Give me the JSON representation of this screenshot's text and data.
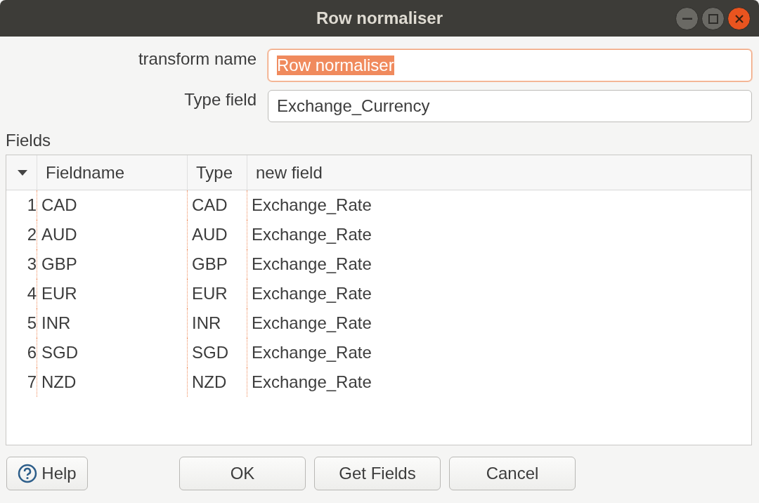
{
  "window": {
    "title": "Row normaliser"
  },
  "form": [
    {
      "label": "transform name",
      "value": "Row normaliser",
      "focused": true
    },
    {
      "label": "Type field",
      "value": "Exchange_Currency",
      "focused": false
    }
  ],
  "fields": {
    "label": "Fields",
    "columns": [
      "Fieldname",
      "Type",
      "new field"
    ],
    "rows": [
      {
        "index": "1",
        "cells": [
          "CAD",
          "CAD",
          "Exchange_Rate"
        ]
      },
      {
        "index": "2",
        "cells": [
          "AUD",
          "AUD",
          "Exchange_Rate"
        ]
      },
      {
        "index": "3",
        "cells": [
          "GBP",
          "GBP",
          "Exchange_Rate"
        ]
      },
      {
        "index": "4",
        "cells": [
          "EUR",
          "EUR",
          "Exchange_Rate"
        ]
      },
      {
        "index": "5",
        "cells": [
          "INR",
          "INR",
          "Exchange_Rate"
        ]
      },
      {
        "index": "6",
        "cells": [
          "SGD",
          "SGD",
          "Exchange_Rate"
        ]
      },
      {
        "index": "7",
        "cells": [
          "NZD",
          "NZD",
          "Exchange_Rate"
        ]
      }
    ]
  },
  "help_button": "Help",
  "buttons": [
    "OK",
    "Get Fields",
    "Cancel"
  ]
}
